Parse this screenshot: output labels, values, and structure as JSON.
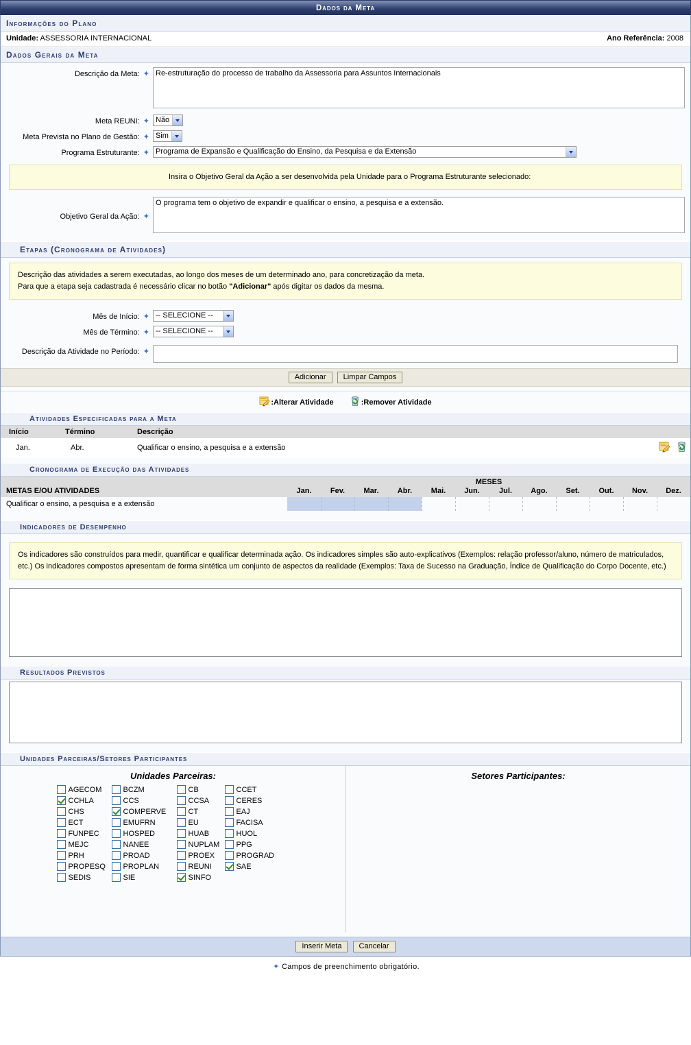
{
  "window": {
    "title": "Dados da Meta"
  },
  "plan_info": {
    "header": "Informações do Plano",
    "unidade_label": "Unidade:",
    "unidade_value": "ASSESSORIA INTERNACIONAL",
    "ano_label": "Ano Referência:",
    "ano_value": "2008"
  },
  "dados_gerais": {
    "header": "Dados Gerais da Meta",
    "descricao_label": "Descrição da Meta:",
    "descricao_value": "Re-estruturação do processo de trabalho da Assessoria para Assuntos Internacionais",
    "meta_reuni_label": "Meta REUNI:",
    "meta_reuni_value": "Não",
    "meta_prevista_label": "Meta Prevista no Plano de Gestão:",
    "meta_prevista_value": "Sim",
    "programa_label": "Programa Estruturante:",
    "programa_value": "Programa de Expansão e Qualificação do Ensino, da Pesquisa e da Extensão",
    "objetivo_hint": "Insira o Objetivo Geral da Ação a ser desenvolvida pela Unidade para o Programa Estruturante selecionado:",
    "objetivo_label": "Objetivo Geral da Ação:",
    "objetivo_value": "O programa tem o objetivo de expandir e qualificar o ensino, a pesquisa e a extensão."
  },
  "etapas": {
    "header": "Etapas (Cronograma de Atividades)",
    "hint_line1": "Descrição das atividades a serem executadas, ao longo dos meses de um determinado ano, para concretização da meta.",
    "hint_line2_a": "Para que a etapa seja cadastrada é necessário clicar no botão ",
    "hint_line2_b": "\"Adicionar\"",
    "hint_line2_c": " após digitar os dados da mesma.",
    "mes_inicio_label": "Mês de Início:",
    "mes_inicio_value": "-- SELECIONE --",
    "mes_termino_label": "Mês de Término:",
    "mes_termino_value": "-- SELECIONE --",
    "desc_atividade_label": "Descrição da Atividade no Período:",
    "desc_atividade_value": "",
    "btn_adicionar": "Adicionar",
    "btn_limpar": "Limpar Campos",
    "legend_alterar": ":Alterar Atividade",
    "legend_remover": ":Remover Atividade",
    "icon_alterar": "edit-note-icon",
    "icon_remover": "recycle-bin-icon"
  },
  "atividades": {
    "header": "Atividades Especificadas para a Meta",
    "columns": [
      "Início",
      "Término",
      "Descrição"
    ],
    "rows": [
      {
        "inicio": "Jan.",
        "termino": "Abr.",
        "descricao": "Qualificar o ensino, a pesquisa e a extensão"
      }
    ]
  },
  "cronograma": {
    "header": "Cronograma de Execução das Atividades",
    "col_metas": "METAS E/OU ATIVIDADES",
    "col_meses": "MESES",
    "months": [
      "Jan.",
      "Fev.",
      "Mar.",
      "Abr.",
      "Mai.",
      "Jun.",
      "Jul.",
      "Ago.",
      "Set.",
      "Out.",
      "Nov.",
      "Dez."
    ],
    "rows": [
      {
        "name": "Qualificar o ensino, a pesquisa e a extensão",
        "active": [
          true,
          true,
          true,
          true,
          false,
          false,
          false,
          false,
          false,
          false,
          false,
          false
        ]
      }
    ],
    "highlight_color": "#c3d2ea"
  },
  "indicadores": {
    "header": "Indicadores de Desempenho",
    "hint": "Os indicadores são construídos para medir, quantificar e qualificar determinada ação. Os indicadores simples são auto-explicativos (Exemplos: relação professor/aluno, número de matriculados, etc.) Os indicadores compostos apresentam de forma sintética um conjunto de aspectos da realidade (Exemplos: Taxa de Sucesso na Graduação, Índice de Qualificação do Corpo Docente, etc.)",
    "value": ""
  },
  "resultados": {
    "header": "Resultados Previstos",
    "value": ""
  },
  "parceiras": {
    "header": "Unidades Parceiras/Setores Participantes",
    "unidades_title": "Unidades Parceiras:",
    "setores_title": "Setores Participantes:",
    "unidades": [
      {
        "label": "AGECOM",
        "checked": false
      },
      {
        "label": "BCZM",
        "checked": false
      },
      {
        "label": "CB",
        "checked": false
      },
      {
        "label": "CCET",
        "checked": false
      },
      {
        "label": "CCHLA",
        "checked": true
      },
      {
        "label": "CCS",
        "checked": false
      },
      {
        "label": "CCSA",
        "checked": false
      },
      {
        "label": "CERES",
        "checked": false
      },
      {
        "label": "CHS",
        "checked": false
      },
      {
        "label": "COMPERVE",
        "checked": true
      },
      {
        "label": "CT",
        "checked": false
      },
      {
        "label": "EAJ",
        "checked": false
      },
      {
        "label": "ECT",
        "checked": false
      },
      {
        "label": "EMUFRN",
        "checked": false
      },
      {
        "label": "EU",
        "checked": false
      },
      {
        "label": "FACISA",
        "checked": false
      },
      {
        "label": "FUNPEC",
        "checked": false
      },
      {
        "label": "HOSPED",
        "checked": false
      },
      {
        "label": "HUAB",
        "checked": false
      },
      {
        "label": "HUOL",
        "checked": false
      },
      {
        "label": "MEJC",
        "checked": false
      },
      {
        "label": "NANEE",
        "checked": false
      },
      {
        "label": "NUPLAM",
        "checked": false
      },
      {
        "label": "PPG",
        "checked": false
      },
      {
        "label": "PRH",
        "checked": false
      },
      {
        "label": "PROAD",
        "checked": false
      },
      {
        "label": "PROEX",
        "checked": false
      },
      {
        "label": "PROGRAD",
        "checked": false
      },
      {
        "label": "PROPESQ",
        "checked": false
      },
      {
        "label": "PROPLAN",
        "checked": false
      },
      {
        "label": "REUNI",
        "checked": false
      },
      {
        "label": "SAE",
        "checked": true
      },
      {
        "label": "SEDIS",
        "checked": false
      },
      {
        "label": "SIE",
        "checked": false
      },
      {
        "label": "SINFO",
        "checked": true
      }
    ],
    "setores": []
  },
  "actions": {
    "btn_inserir": "Inserir Meta",
    "btn_cancelar": "Cancelar"
  },
  "footnote": "Campos de preenchimento obrigatório."
}
